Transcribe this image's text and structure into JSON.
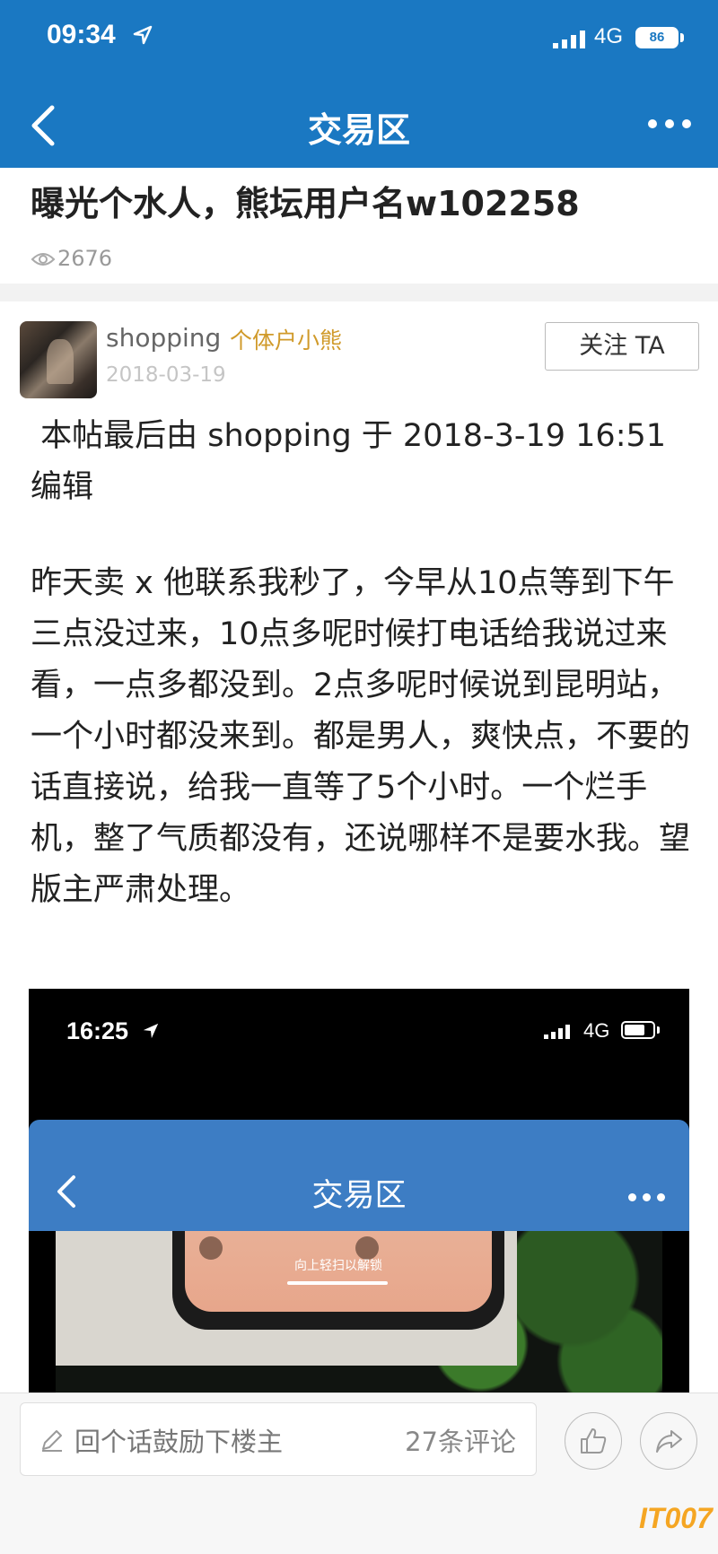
{
  "status_bar": {
    "time": "09:34",
    "network": "4G",
    "battery": "86"
  },
  "nav": {
    "title": "交易区"
  },
  "post": {
    "title": "曝光个水人，熊坛用户名w102258",
    "views": "2676"
  },
  "author": {
    "username": "shopping",
    "tag": "个体户小熊",
    "date": "2018-03-19",
    "follow_label": "关注 TA"
  },
  "content": {
    "edit_note": " 本帖最后由 shopping 于 2018-3-19 16:51 编辑",
    "body": "昨天卖 x 他联系我秒了，今早从10点等到下午三点没过来，10点多呢时候打电话给我说过来看，一点多都没到。2点多呢时候说到昆明站，一个小时都没来到。都是男人，爽快点，不要的话直接说，给我一直等了5个小时。一个烂手机，整了气质都没有，还说哪样不是要水我。望版主严肃处理。"
  },
  "embedded_screenshot": {
    "time": "16:25",
    "network": "4G",
    "title": "交易区",
    "unlock_text": "向上轻扫以解锁"
  },
  "bottom_bar": {
    "comment_placeholder": "回个话鼓励下楼主",
    "comment_count": "27条评论"
  },
  "watermark": "IT007",
  "colors": {
    "header": "#1a78c2",
    "tag": "#d09a2a",
    "embed_header": "#3d7dc4"
  },
  "icons": [
    "location-arrow-icon",
    "signal-icon",
    "battery-icon",
    "back-icon",
    "more-icon",
    "eye-icon",
    "pencil-icon",
    "thumbs-up-icon",
    "share-icon"
  ]
}
